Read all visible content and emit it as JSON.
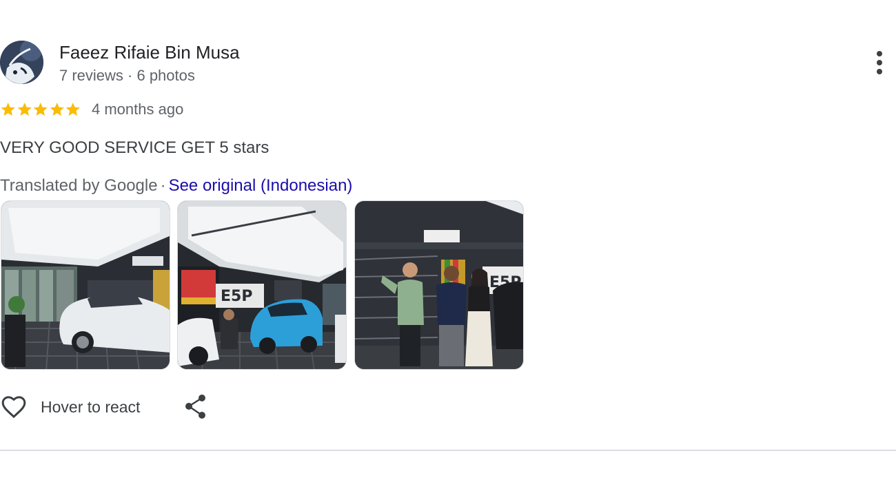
{
  "reviewer": {
    "name": "Faeez Rifaie Bin Musa",
    "meta": "7 reviews · 6 photos"
  },
  "rating": {
    "stars": 5,
    "max_stars": 5,
    "star_color": "#fbbc04",
    "time_ago": "4 months ago"
  },
  "review": {
    "text": "VERY GOOD SERVICE GET 5 stars",
    "translated_by": "Translated by Google",
    "separator": "·",
    "see_original": "See original (Indonesian)"
  },
  "photos": [
    {
      "subject": "white-car-showroom"
    },
    {
      "subject": "blue-car-workshop"
    },
    {
      "subject": "group-photo"
    }
  ],
  "actions": {
    "react_label": "Hover to react"
  },
  "colors": {
    "link": "#1a0dab",
    "secondary_text": "#5f6368",
    "divider": "#dadce0"
  }
}
